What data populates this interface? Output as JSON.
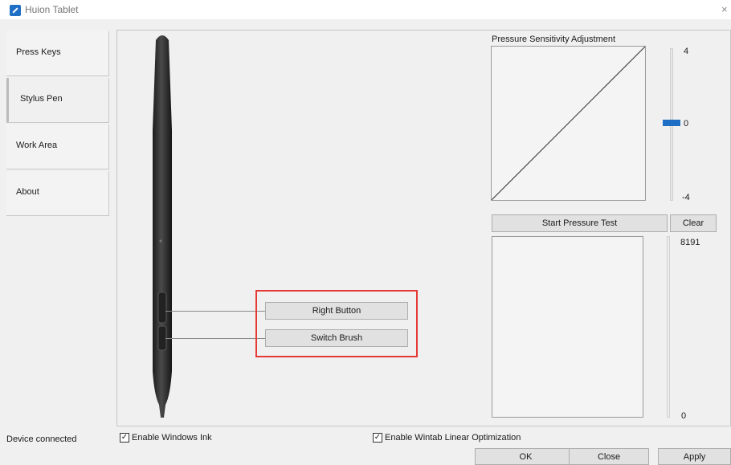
{
  "window": {
    "title": "Huion Tablet",
    "close_glyph": "×"
  },
  "tabs": [
    {
      "label": "Press Keys"
    },
    {
      "label": "Stylus Pen"
    },
    {
      "label": "Work Area"
    },
    {
      "label": "About"
    }
  ],
  "pressure": {
    "title": "Pressure Sensitivity Adjustment",
    "slider_max": "4",
    "slider_current": "0",
    "slider_min": "-4",
    "test_button": "Start Pressure Test",
    "clear_button": "Clear",
    "test_max": "8191",
    "test_min": "0"
  },
  "pen_buttons": {
    "upper": "Right Button",
    "lower": "Switch Brush"
  },
  "options": {
    "windows_ink": "Enable  Windows Ink",
    "wintab_linear": "Enable Wintab Linear Optimization"
  },
  "status": {
    "text": "Device connected"
  },
  "footer": {
    "ok": "OK",
    "close": "Close",
    "apply": "Apply"
  },
  "colors": {
    "accent": "#1f6fc5",
    "highlight": "#e53935",
    "pen_body": "#2a2a2a"
  },
  "icons": {
    "app": "huion-app-icon",
    "close": "close-icon",
    "check": "checkmark-icon"
  }
}
